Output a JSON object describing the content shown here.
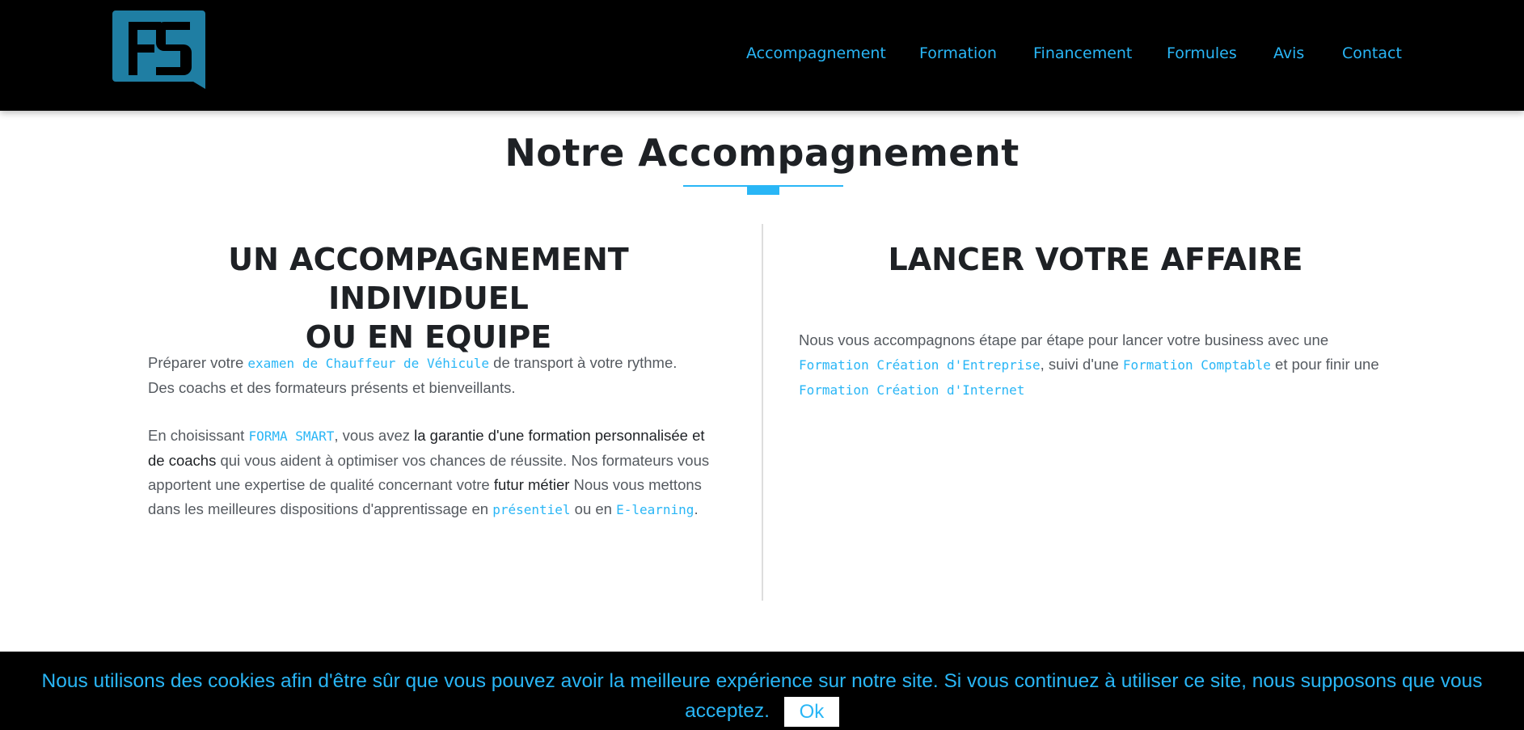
{
  "header": {
    "logo_text": "FS",
    "nav": [
      {
        "label": "Accompagnement"
      },
      {
        "label": "Formation"
      },
      {
        "label": "Financement"
      },
      {
        "label": "Formules"
      },
      {
        "label": "Avis"
      },
      {
        "label": "Contact"
      }
    ]
  },
  "main": {
    "title": "Notre Accompagnement",
    "left": {
      "heading_line1": "UN ACCOMPAGNEMENT INDIVIDUEL",
      "heading_line2": "OU EN EQUIPE",
      "p1": {
        "t1": "Préparer votre ",
        "code1": "examen de Chauffeur de Véhicule",
        "t2": " de transport à votre rythme. Des coachs et des formateurs présents et bienveillants."
      },
      "p2": {
        "t1": "En choisissant ",
        "code1": "FORMA SMART",
        "t2": ", vous avez ",
        "strong1": "la garantie d'une formation personnalisée et de coachs",
        "t3": " qui vous aident à optimiser vos chances de réussite. Nos formateurs vous apportent une expertise de qualité concernant votre ",
        "strong2": "futur métier",
        "t4": " Nous vous mettons dans les meilleures dispositions d'apprentissage en ",
        "code2": "présentiel",
        "t5": " ou en ",
        "code3": "E-learning",
        "t6": "."
      }
    },
    "right": {
      "heading": "LANCER VOTRE AFFAIRE",
      "p": {
        "t1": "Nous vous accompagnons étape par étape pour lancer votre business avec une ",
        "code1": "Formation Création d'Entreprise",
        "t2": ", suivi d'une ",
        "code2": "Formation Comptable",
        "t3": " et pour finir une ",
        "code3": "Formation Création d'Internet"
      }
    }
  },
  "cookie": {
    "message": "Nous utilisons des cookies afin d'être sûr que vous pouvez avoir la meilleure expérience sur notre site. Si vous continuez à utiliser ce site, nous supposons que vous acceptez.",
    "ok_label": "Ok"
  },
  "colors": {
    "accent": "#29b6f6",
    "header_bg": "#000000",
    "heading_text": "#1e2125",
    "body_text": "#555a60"
  }
}
